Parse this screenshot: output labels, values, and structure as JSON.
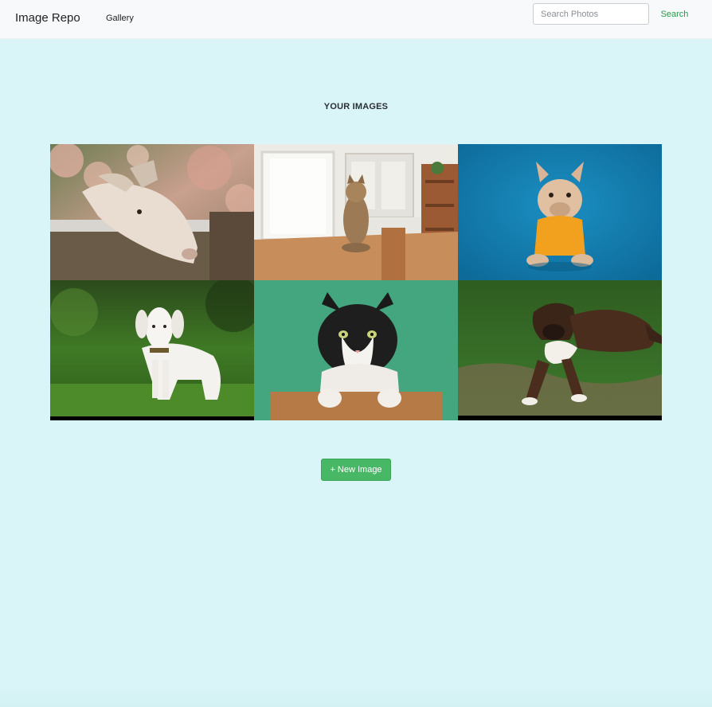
{
  "navbar": {
    "brand": "Image Repo",
    "links": [
      {
        "label": "Gallery"
      }
    ],
    "search": {
      "placeholder": "Search Photos",
      "value": "",
      "button_label": "Search"
    }
  },
  "main": {
    "title": "YOUR IMAGES",
    "images": [
      {
        "subject": "goat",
        "background": "pink flowering shrub"
      },
      {
        "subject": "cat",
        "background": "kitchen table"
      },
      {
        "subject": "french bulldog",
        "background": "blue backdrop"
      },
      {
        "subject": "white goat",
        "background": "green grass"
      },
      {
        "subject": "black and white cat",
        "background": "teal wall"
      },
      {
        "subject": "brindle boxer dog",
        "background": "grass"
      }
    ],
    "new_image_label": "+ New Image"
  },
  "colors": {
    "page_background": "#d9f5f8",
    "navbar_background": "#f8f9fa",
    "accent_green": "#49b866",
    "search_green": "#1f9d47"
  }
}
